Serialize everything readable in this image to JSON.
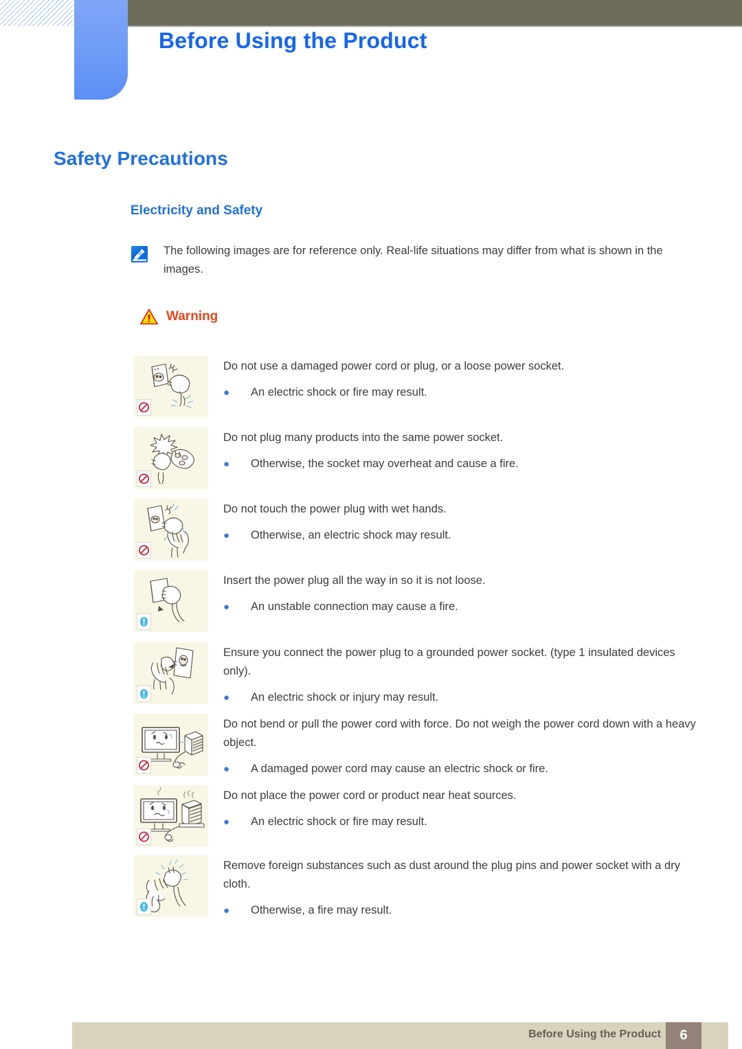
{
  "header": {
    "chapter_title": "Before Using the Product",
    "band_color": "#6e6c58",
    "tab_color": "#6d9bf6"
  },
  "headings": {
    "section_title": "Safety Precautions",
    "subsection_title": "Electricity and Safety",
    "heading_color": "#2070e0"
  },
  "note": {
    "icon": "note-pen-icon",
    "text": "The following images are for reference only. Real-life situations may differ from what is shown in the images."
  },
  "warning": {
    "icon": "warning-triangle-icon",
    "label": "Warning",
    "label_color": "#e8461a"
  },
  "items": [
    {
      "illustration": "damaged-power-plug-illustration",
      "badge": "prohibition-badge",
      "main": "Do not use a damaged power cord or plug, or a loose power socket.",
      "bullets": [
        "An electric shock or fire may result."
      ]
    },
    {
      "illustration": "overloaded-power-strip-illustration",
      "badge": "prohibition-badge",
      "main": "Do not plug many products into the same power socket.",
      "bullets": [
        "Otherwise, the socket may overheat and cause a fire."
      ]
    },
    {
      "illustration": "wet-hands-plug-illustration",
      "badge": "prohibition-badge",
      "main": "Do not touch the power plug with wet hands.",
      "bullets": [
        "Otherwise, an electric shock may result."
      ]
    },
    {
      "illustration": "insert-plug-fully-illustration",
      "badge": "mandatory-badge",
      "main": "Insert the power plug all the way in so it is not loose.",
      "bullets": [
        "An unstable connection may cause a fire."
      ]
    },
    {
      "illustration": "grounded-socket-illustration",
      "badge": "mandatory-badge",
      "main": "Ensure you connect the power plug to a grounded power socket. (type 1 insulated devices only).",
      "bullets": [
        "An electric shock or injury may result."
      ]
    },
    {
      "illustration": "bent-cord-heavy-object-illustration",
      "badge": "prohibition-badge",
      "main": "Do not bend or pull the power cord with force. Do not weigh the power cord down with a heavy object.",
      "bullets": [
        "A damaged power cord may cause an electric shock or fire."
      ]
    },
    {
      "illustration": "cord-near-heat-source-illustration",
      "badge": "prohibition-badge",
      "main": "Do not place the power cord or product near heat sources.",
      "bullets": [
        "An electric shock or fire may result."
      ]
    },
    {
      "illustration": "clean-plug-pins-illustration",
      "badge": "mandatory-badge",
      "main": "Remove foreign substances such as dust around the plug pins and power socket with a dry cloth.",
      "bullets": [
        "Otherwise, a fire may result."
      ]
    }
  ],
  "footer": {
    "label": "Before Using the Product",
    "page_number": "6",
    "bar_color": "#d8d3bd",
    "page_box_color": "#938277"
  }
}
